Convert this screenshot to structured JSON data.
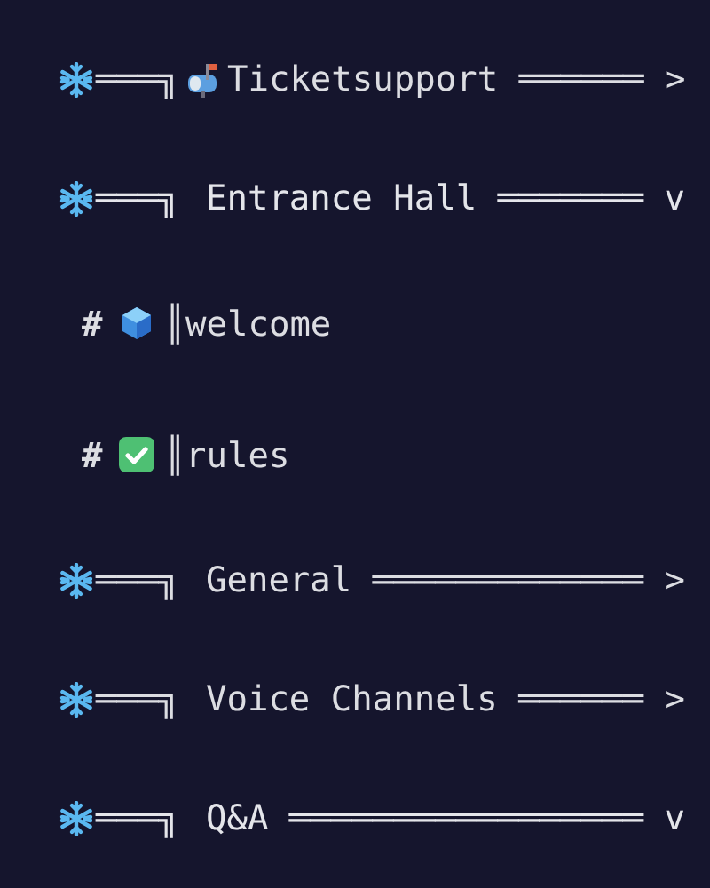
{
  "categories": [
    {
      "line": "═══╗",
      "kind": "mailbox",
      "label": "Ticketsupport ══════ >",
      "expanded": false
    },
    {
      "line": "═══╗",
      "label": "Entrance Hall ═══════ v",
      "expanded": true,
      "children": [
        {
          "prefix": "#",
          "kind": "cube",
          "name": "║welcome"
        },
        {
          "prefix": "#",
          "kind": "check",
          "name": "║rules"
        }
      ]
    },
    {
      "line": "═══╗",
      "label": "General ═════════════ >",
      "expanded": false
    },
    {
      "line": "═══╗",
      "label": "Voice Channels ══════ >",
      "expanded": false
    },
    {
      "line": "═══╗",
      "label": "Q&A ═════════════════ v",
      "expanded": true
    }
  ]
}
